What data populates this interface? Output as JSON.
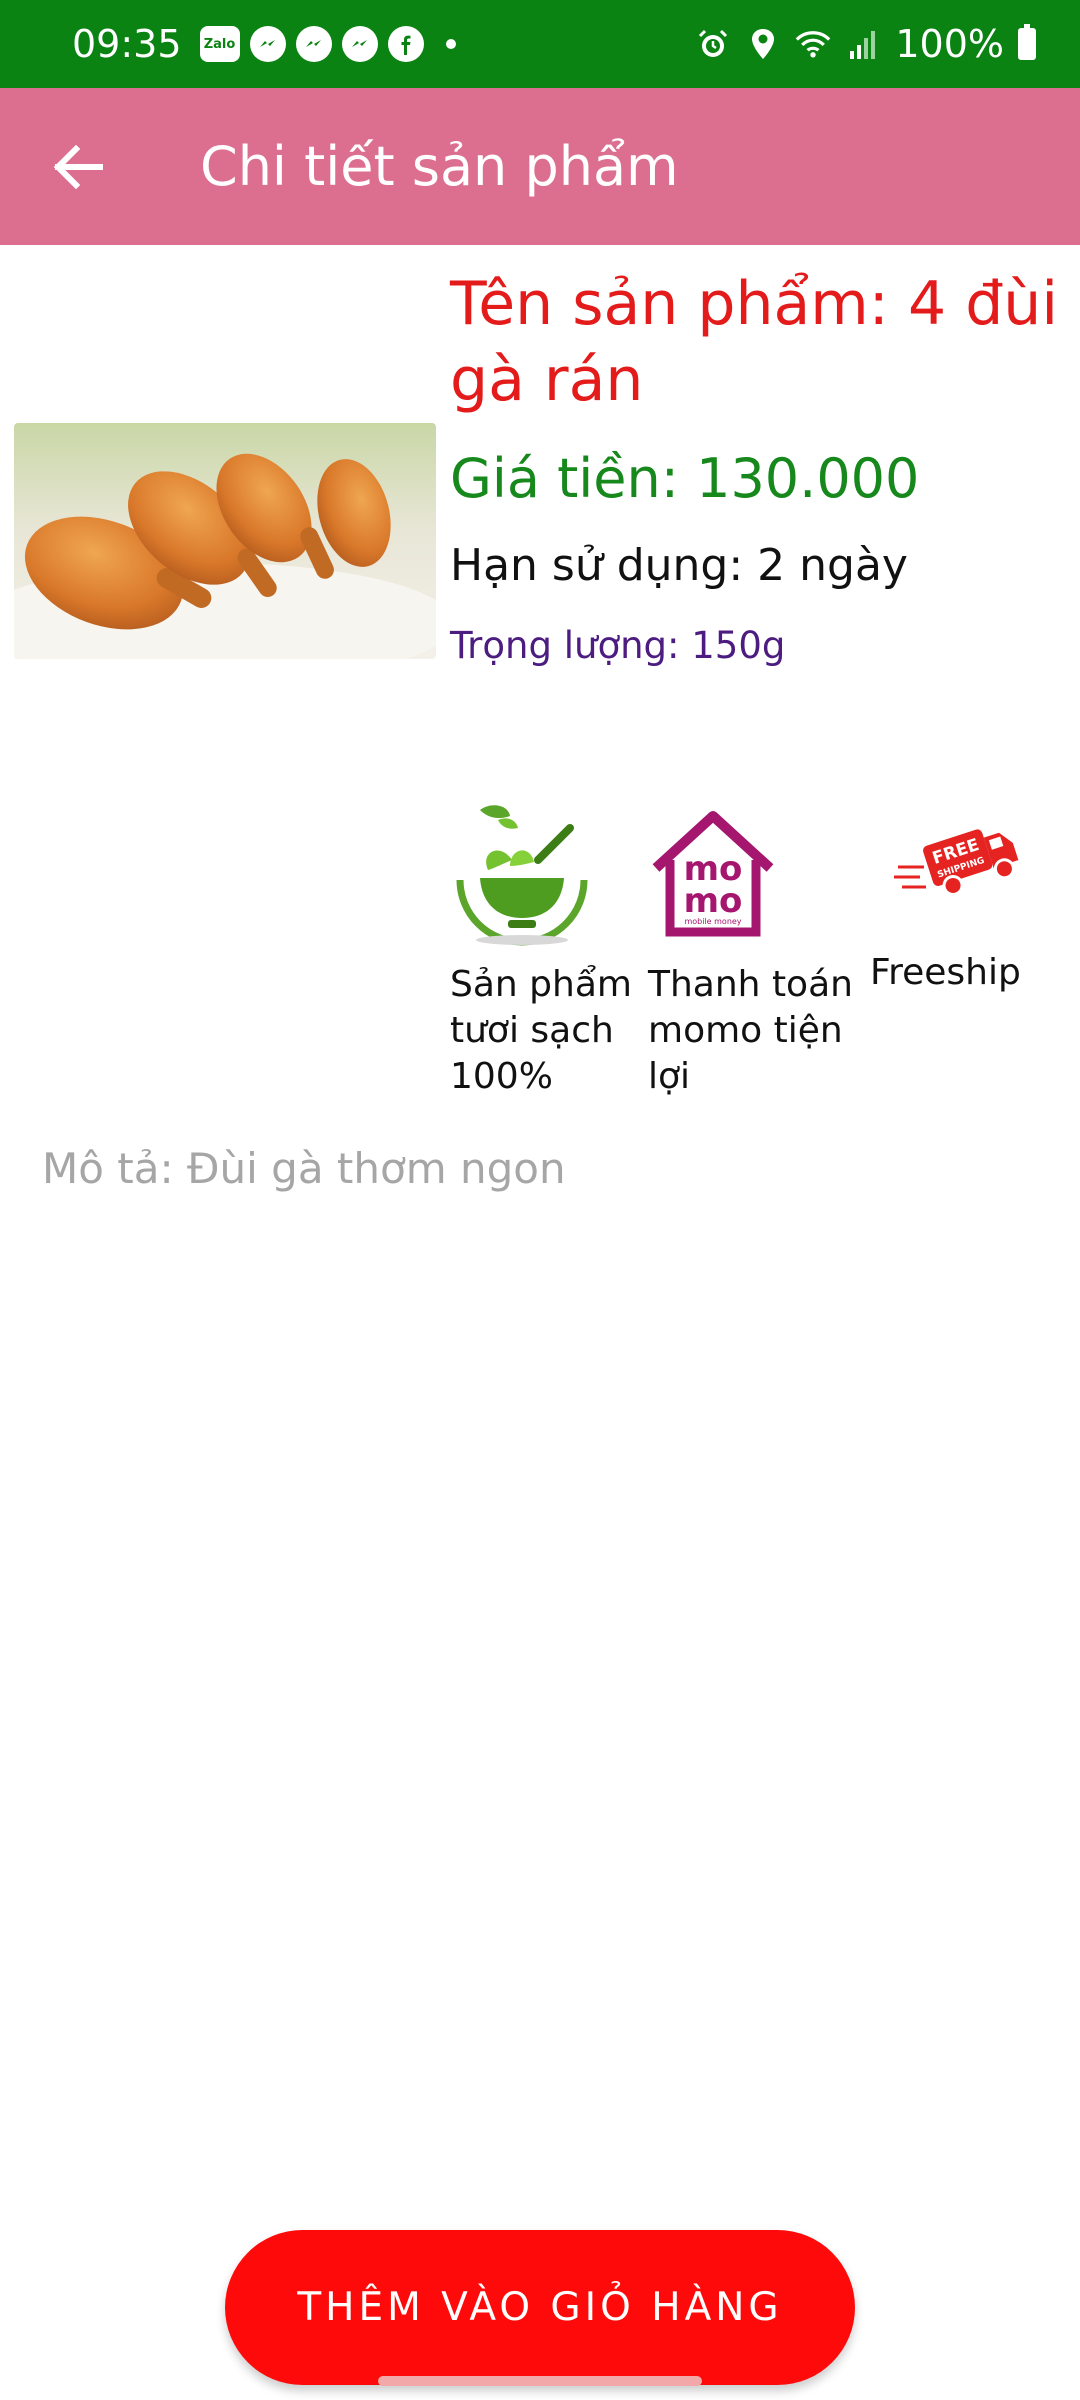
{
  "status_bar": {
    "time": "09:35",
    "notifications": [
      "zalo-icon",
      "messenger-icon",
      "messenger-icon",
      "messenger-icon",
      "facebook-icon"
    ],
    "zalo_text": "Zalo",
    "battery": "100%",
    "system_icons": [
      "alarm-icon",
      "location-icon",
      "wifi-icon",
      "signal-icon",
      "battery-icon"
    ]
  },
  "app_bar": {
    "title": "Chi tiết sản phẩm",
    "back_icon": "arrow-left-icon"
  },
  "product": {
    "name": "Tên sản phẩm: 4 đùi gà rán",
    "price": "Giá tiền: 130.000",
    "expiry": "Hạn sử dụng: 2 ngày",
    "weight": "Trọng lượng: 150g",
    "image": "fried-chicken-image",
    "description": "Mô tả: Đùi gà thơm ngon"
  },
  "features": [
    {
      "icon": "fresh-leaf-bowl-icon",
      "label": "Sản phẩm tươi sạch 100%"
    },
    {
      "icon": "momo-icon",
      "label": "Thanh toán momo tiện lợi",
      "icon_text_top": "mo",
      "icon_text_bottom": "mo",
      "icon_caption": "mobile money"
    },
    {
      "icon": "free-shipping-truck-icon",
      "label": "Freeship",
      "icon_text_top": "FREE",
      "icon_text_bottom": "SHIPPING"
    }
  ],
  "actions": {
    "add_to_cart": "THÊM VÀO GIỎ HÀNG"
  },
  "colors": {
    "status_bar": "#0b8312",
    "app_bar": "#dc6f8f",
    "name": "#e31b1b",
    "price": "#16881c",
    "weight": "#4c1c80",
    "button": "#ff0a0a"
  }
}
